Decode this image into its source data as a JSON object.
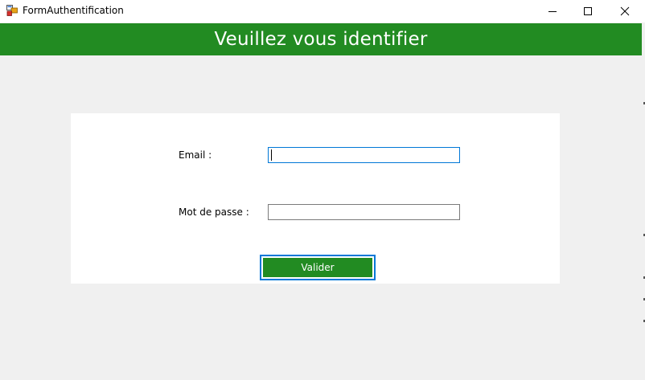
{
  "window": {
    "title": "FormAuthentification",
    "controls": [
      "minimize-icon",
      "maximize-icon",
      "close-icon"
    ]
  },
  "header": {
    "title": "Veuillez vous identifier",
    "background_color": "#228b22"
  },
  "form": {
    "email_label": "Email :",
    "email_value": "",
    "password_label": "Mot de passe :",
    "password_value": "",
    "submit_label": "Valider",
    "submit_color": "#228b22",
    "focus_color": "#0078d7"
  }
}
